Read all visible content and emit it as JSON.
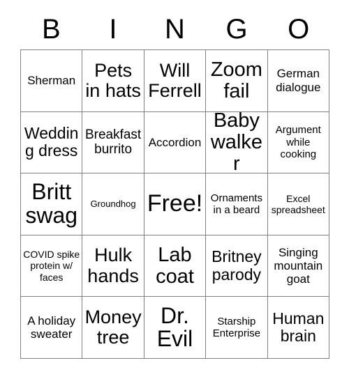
{
  "card": {
    "title": "Bingo Card",
    "header_letters": [
      "B",
      "I",
      "N",
      "G",
      "O"
    ],
    "colors": {
      "background": "#ffffff",
      "text": "#000000",
      "grid_line": "#808080"
    },
    "grid": {
      "rows": 5,
      "columns": 5,
      "free_space_label": "Free!",
      "free_space_position": {
        "row": 3,
        "column": 3
      }
    },
    "cells": [
      [
        {
          "text": "Sherman",
          "size": "md"
        },
        {
          "text": "Pets in hats",
          "size": "2xl"
        },
        {
          "text": "Will Ferrell",
          "size": "2xl"
        },
        {
          "text": "Zoom fail",
          "size": "3xl"
        },
        {
          "text": "German dialogue",
          "size": "md"
        }
      ],
      [
        {
          "text": "Wedding dress",
          "size": "xl"
        },
        {
          "text": "Breakfast burrito",
          "size": "lg"
        },
        {
          "text": "Accordion",
          "size": "md"
        },
        {
          "text": "Baby walker",
          "size": "3xl"
        },
        {
          "text": "Argument while cooking",
          "size": "sm"
        }
      ],
      [
        {
          "text": "Britt swag",
          "size": "4xl"
        },
        {
          "text": "Groundhog",
          "size": "xxs"
        },
        {
          "text": "Free!",
          "size": "5xl"
        },
        {
          "text": "Ornaments in a beard",
          "size": "sm"
        },
        {
          "text": "Excel spreadsheet",
          "size": "xs"
        }
      ],
      [
        {
          "text": "COVID spike protein w/ faces",
          "size": "xs"
        },
        {
          "text": "Hulk hands",
          "size": "2xl"
        },
        {
          "text": "Lab coat",
          "size": "3xl"
        },
        {
          "text": "Britney parody",
          "size": "xl"
        },
        {
          "text": "Singing mountain goat",
          "size": "md"
        }
      ],
      [
        {
          "text": "A holiday sweater",
          "size": "md"
        },
        {
          "text": "Money tree",
          "size": "2xl"
        },
        {
          "text": "Dr. Evil",
          "size": "4xl"
        },
        {
          "text": "Starship Enterprise",
          "size": "sm"
        },
        {
          "text": "Human brain",
          "size": "xl"
        }
      ]
    ]
  }
}
